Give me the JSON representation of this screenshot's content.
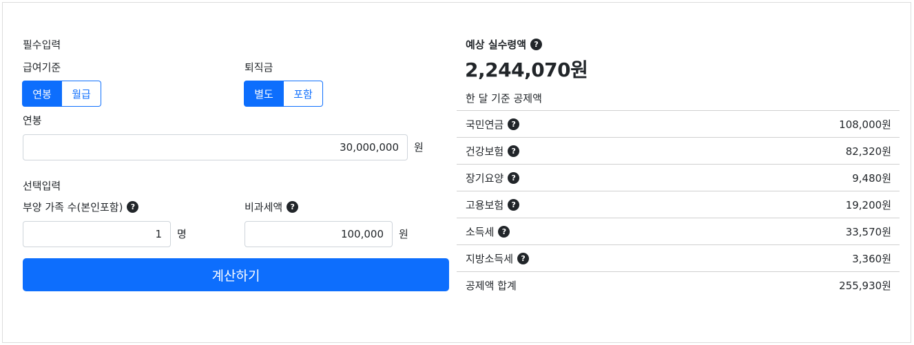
{
  "required_section": {
    "title": "필수입력",
    "salary_basis": {
      "label": "급여기준",
      "options": [
        "연봉",
        "월급"
      ],
      "selected": "연봉"
    },
    "severance": {
      "label": "퇴직금",
      "options": [
        "별도",
        "포함"
      ],
      "selected": "별도"
    },
    "annual_salary": {
      "label": "연봉",
      "value": "30,000,000",
      "unit": "원"
    }
  },
  "optional_section": {
    "title": "선택입력",
    "dependents": {
      "label": "부양 가족 수(본인포함)",
      "value": "1",
      "unit": "명"
    },
    "non_taxable": {
      "label": "비과세액",
      "value": "100,000",
      "unit": "원"
    }
  },
  "calculate_button": "계산하기",
  "result": {
    "label": "예상 실수령액",
    "amount": "2,244,070원",
    "deduction_caption": "한 달 기준 공제액",
    "deductions": [
      {
        "name": "국민연금",
        "value": "108,000원",
        "help": true
      },
      {
        "name": "건강보험",
        "value": "82,320원",
        "help": true
      },
      {
        "name": "장기요양",
        "value": "9,480원",
        "help": true
      },
      {
        "name": "고용보험",
        "value": "19,200원",
        "help": true
      },
      {
        "name": "소득세",
        "value": "33,570원",
        "help": true
      },
      {
        "name": "지방소득세",
        "value": "3,360원",
        "help": true
      },
      {
        "name": "공제액 합계",
        "value": "255,930원",
        "help": false
      }
    ]
  },
  "help_glyph": "?",
  "colors": {
    "primary": "#0d6efd",
    "text": "#212529",
    "border": "#ced4da"
  }
}
